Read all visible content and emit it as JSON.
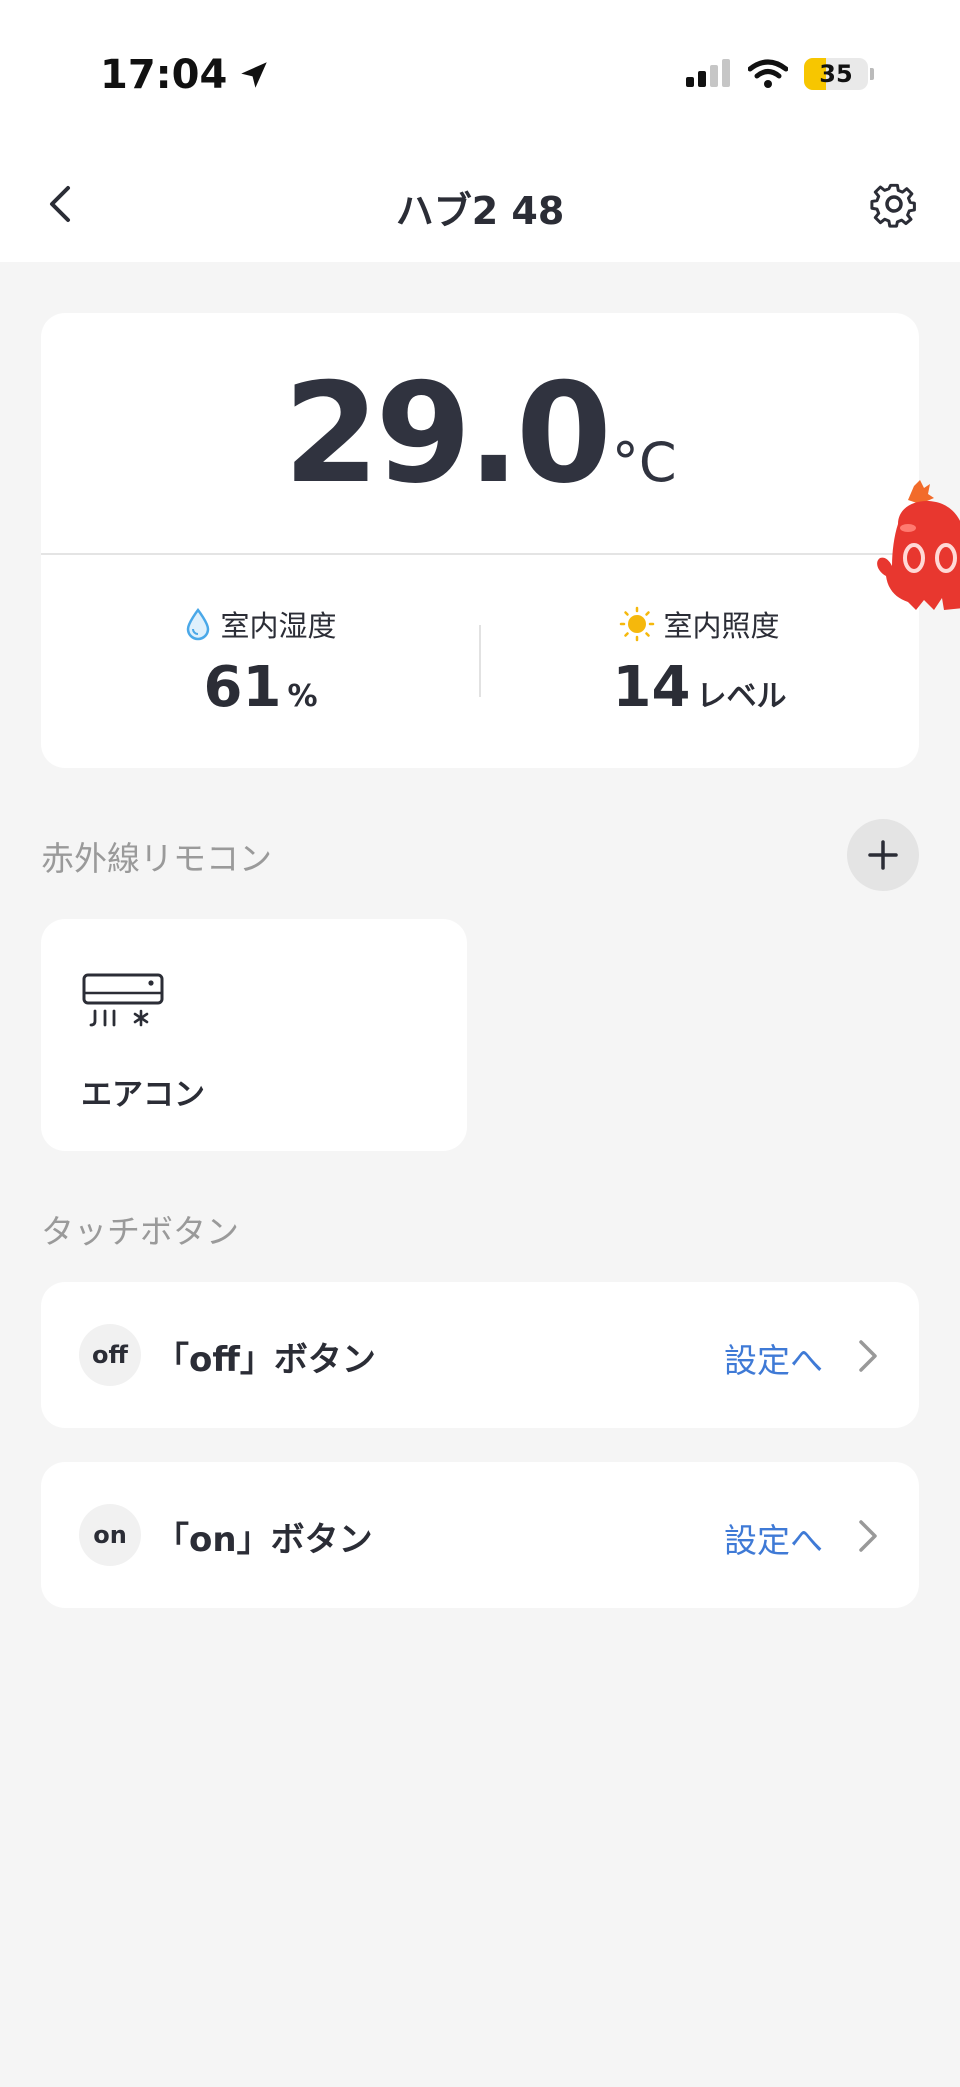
{
  "status_bar": {
    "time": "17:04",
    "battery": "35",
    "battery_level": 0.35,
    "battery_color": "#f7c600"
  },
  "nav": {
    "title": "ハブ2 48",
    "back_icon": "chevron-left-icon",
    "settings_icon": "gear-icon"
  },
  "sensor": {
    "temperature": "29.0",
    "temperature_unit": "°C",
    "humidity_label": "室内湿度",
    "humidity_value": "61",
    "humidity_unit": "%",
    "light_label": "室内照度",
    "light_value": "14",
    "light_unit": "レベル"
  },
  "ir_remote": {
    "section_label": "赤外線リモコン",
    "add_icon": "plus-icon",
    "devices": [
      {
        "label": "エアコン",
        "icon": "air-conditioner-icon"
      }
    ]
  },
  "touch_buttons": {
    "section_label": "タッチボタン",
    "items": [
      {
        "badge": "off",
        "label": "「off」ボタン",
        "link": "設定へ"
      },
      {
        "badge": "on",
        "label": "「on」ボタン",
        "link": "設定へ"
      }
    ]
  },
  "colors": {
    "accent_link": "#3f7ad6",
    "humidity_icon": "#4aa8e8",
    "light_icon": "#f5b80c",
    "mascot": "#e8372f"
  }
}
